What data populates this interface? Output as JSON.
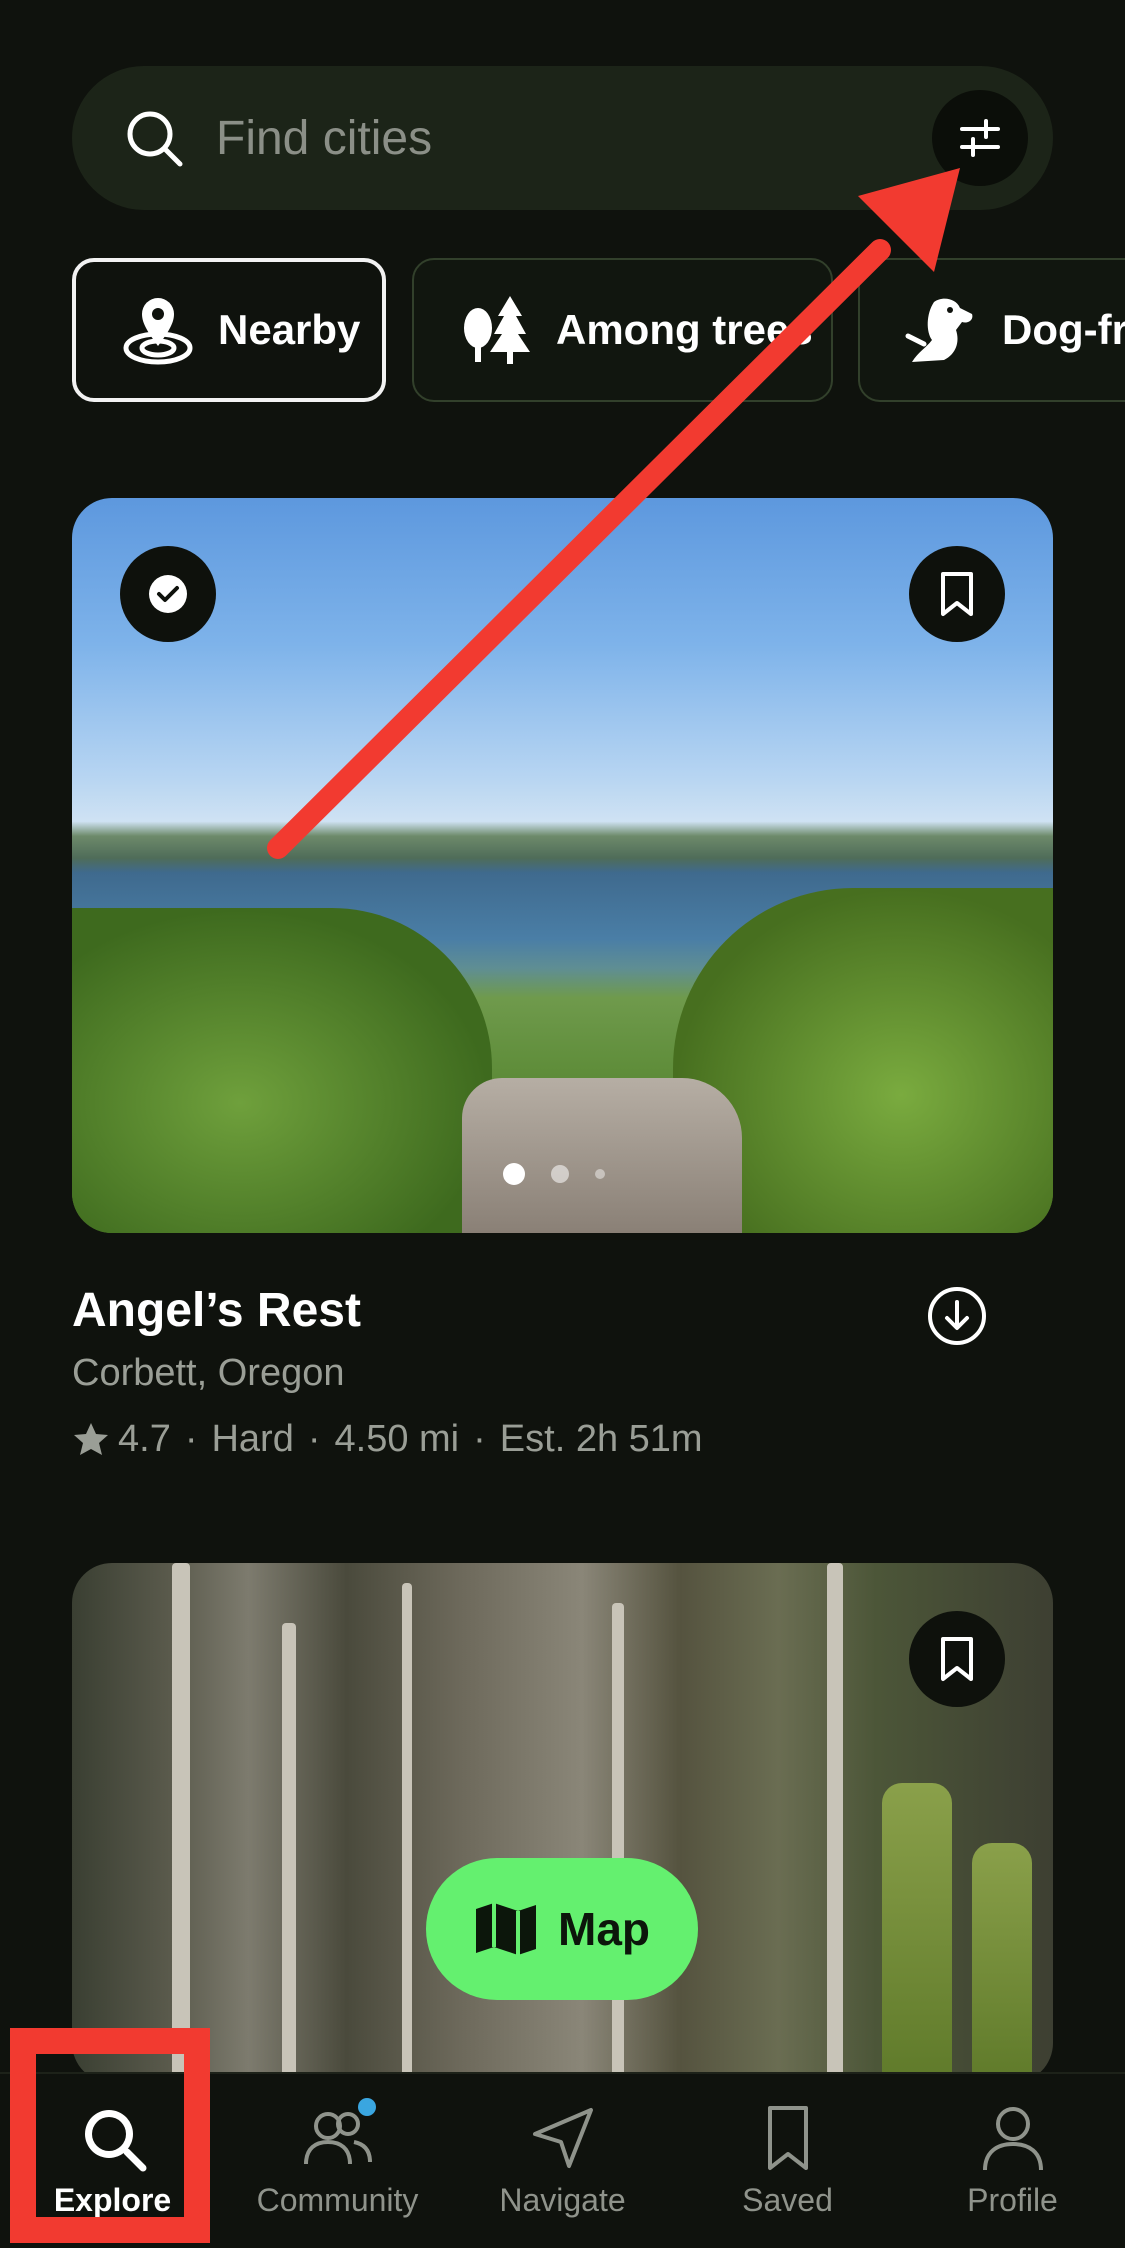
{
  "search": {
    "placeholder": "Find cities",
    "filter_icon": "sliders-icon"
  },
  "chips": [
    {
      "label": "Nearby",
      "icon": "nearby-pin-icon",
      "active": true
    },
    {
      "label": "Among trees",
      "icon": "trees-icon",
      "active": false
    },
    {
      "label": "Dog-fr",
      "icon": "dog-icon",
      "active": false
    }
  ],
  "cards": [
    {
      "title": "Angel’s Rest",
      "location": "Corbett, Oregon",
      "rating": "4.7",
      "difficulty": "Hard",
      "length": "4.50 mi",
      "estimate": "Est. 2h 51m",
      "completed": true,
      "image_count": 3
    },
    {
      "image": "forest"
    }
  ],
  "map_button": {
    "label": "Map",
    "icon": "map-icon",
    "color": "#64f06f"
  },
  "bottom_nav": [
    {
      "label": "Explore",
      "icon": "search-icon",
      "active": true
    },
    {
      "label": "Community",
      "icon": "community-icon",
      "active": false,
      "notification": true
    },
    {
      "label": "Navigate",
      "icon": "navigate-icon",
      "active": false
    },
    {
      "label": "Saved",
      "icon": "bookmark-icon",
      "active": false
    },
    {
      "label": "Profile",
      "icon": "profile-icon",
      "active": false
    }
  ],
  "annotations": {
    "color": "#f23a30",
    "arrow_target": "filter-button",
    "highlight_target": "nav-explore"
  },
  "colors": {
    "background": "#0f120d",
    "accent": "#64f06f",
    "notification": "#3aa6e0"
  }
}
